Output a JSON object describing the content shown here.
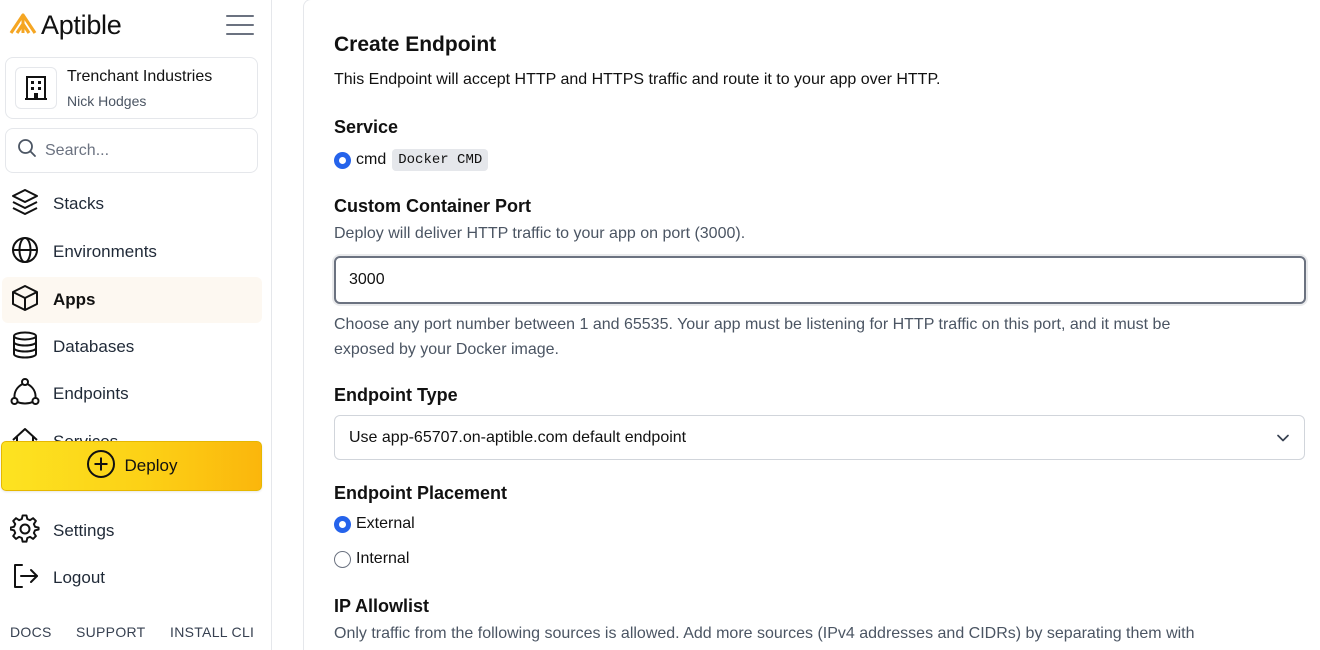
{
  "sidebar": {
    "brand": "Aptible",
    "org": {
      "name": "Trenchant Industries",
      "user": "Nick Hodges"
    },
    "search": {
      "placeholder": "Search..."
    },
    "nav": [
      {
        "label": "Stacks",
        "icon": "layers-icon"
      },
      {
        "label": "Environments",
        "icon": "globe-icon"
      },
      {
        "label": "Apps",
        "icon": "cube-icon",
        "active": true
      },
      {
        "label": "Databases",
        "icon": "database-icon"
      },
      {
        "label": "Endpoints",
        "icon": "network-icon"
      },
      {
        "label": "Services",
        "icon": "services-icon"
      }
    ],
    "deploy_label": "Deploy",
    "bottom_nav": [
      {
        "label": "Settings",
        "icon": "gear-icon"
      },
      {
        "label": "Logout",
        "icon": "logout-icon"
      }
    ],
    "footer": [
      "DOCS",
      "SUPPORT",
      "INSTALL CLI"
    ]
  },
  "form": {
    "title": "Create Endpoint",
    "description": "This Endpoint will accept HTTP and HTTPS traffic and route it to your app over HTTP.",
    "service": {
      "label": "Service",
      "option": "cmd",
      "option_code": "Docker CMD",
      "selected": true
    },
    "port": {
      "label": "Custom Container Port",
      "help_top": "Deploy will deliver HTTP traffic to your app on port (3000).",
      "value": "3000",
      "help_bottom_1": "Choose any port number between 1 and 65535. Your app must be listening for HTTP traffic on this port, and it must be",
      "help_bottom_2": "exposed by your Docker image."
    },
    "endpoint_type": {
      "label": "Endpoint Type",
      "selected": "Use app-65707.on-aptible.com default endpoint"
    },
    "placement": {
      "label": "Endpoint Placement",
      "options": [
        {
          "label": "External",
          "checked": true
        },
        {
          "label": "Internal",
          "checked": false
        }
      ]
    },
    "ip_allowlist": {
      "label": "IP Allowlist",
      "help": "Only traffic from the following sources is allowed. Add more sources (IPv4 addresses and CIDRs) by separating them with"
    }
  },
  "colors": {
    "accent": "#2563eb",
    "deploy_from": "#fde321",
    "deploy_to": "#fbb60c",
    "brand_orange": "#f5a623"
  }
}
